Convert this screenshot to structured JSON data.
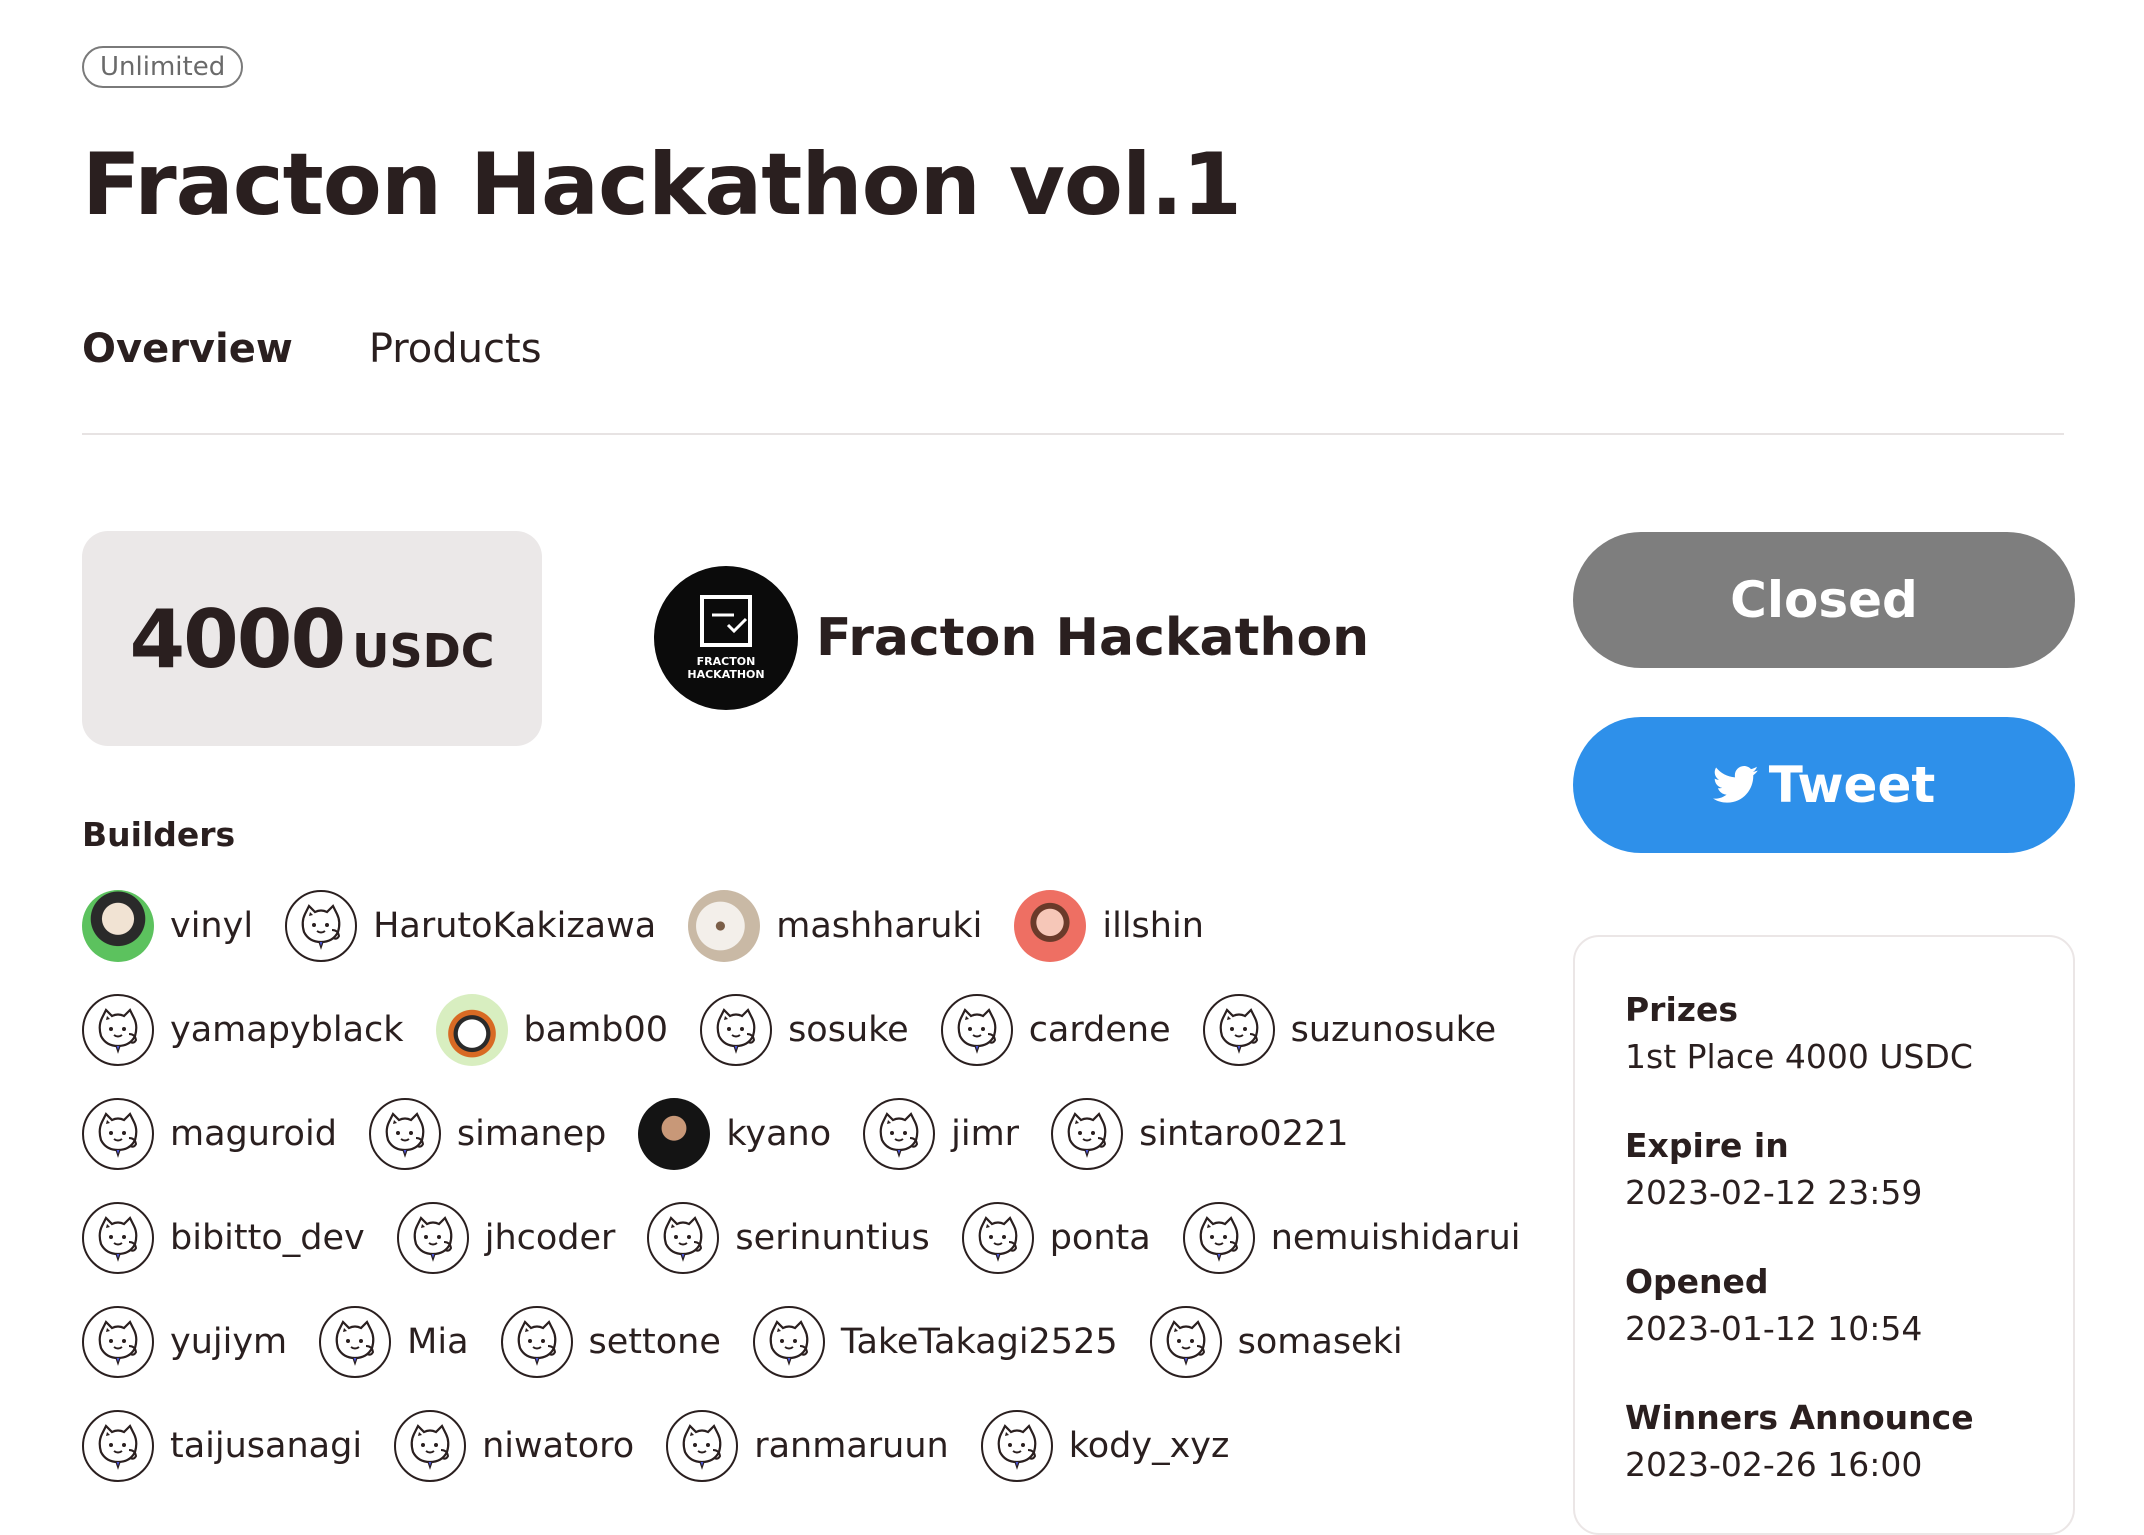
{
  "badge": "Unlimited",
  "title": "Fracton Hackathon vol.1",
  "tabs": [
    {
      "label": "Overview",
      "active": true
    },
    {
      "label": "Products",
      "active": false
    }
  ],
  "prize": {
    "amount": "4000",
    "unit": "USDC"
  },
  "organizer": {
    "name": "Fracton Hackathon",
    "logo_text_1": "FRACTON",
    "logo_text_2": "HACKATHON"
  },
  "builders_heading": "Builders",
  "builders": [
    [
      {
        "name": "vinyl",
        "avatar": "photo-green"
      },
      {
        "name": "HarutoKakizawa",
        "avatar": "cat-icon"
      },
      {
        "name": "mashharuki",
        "avatar": "photo-dog"
      },
      {
        "name": "illshin",
        "avatar": "photo-red"
      }
    ],
    [
      {
        "name": "yamapyblack",
        "avatar": "cat-icon"
      },
      {
        "name": "bamb00",
        "avatar": "photo-panda"
      },
      {
        "name": "sosuke",
        "avatar": "cat-icon"
      },
      {
        "name": "cardene",
        "avatar": "cat-icon"
      },
      {
        "name": "suzunosuke",
        "avatar": "cat-icon"
      }
    ],
    [
      {
        "name": "maguroid",
        "avatar": "cat-icon"
      },
      {
        "name": "simanep",
        "avatar": "cat-icon"
      },
      {
        "name": "kyano",
        "avatar": "photo-person"
      },
      {
        "name": "jimr",
        "avatar": "cat-icon"
      },
      {
        "name": "sintaro0221",
        "avatar": "cat-icon"
      }
    ],
    [
      {
        "name": "bibitto_dev",
        "avatar": "cat-icon"
      },
      {
        "name": "jhcoder",
        "avatar": "cat-icon"
      },
      {
        "name": "serinuntius",
        "avatar": "cat-icon"
      },
      {
        "name": "ponta",
        "avatar": "cat-icon"
      },
      {
        "name": "nemuishidarui",
        "avatar": "cat-icon"
      }
    ],
    [
      {
        "name": "yujiym",
        "avatar": "cat-icon"
      },
      {
        "name": "Mia",
        "avatar": "cat-icon"
      },
      {
        "name": "settone",
        "avatar": "cat-icon"
      },
      {
        "name": "TakeTakagi2525",
        "avatar": "cat-icon"
      },
      {
        "name": "somaseki",
        "avatar": "cat-icon"
      }
    ],
    [
      {
        "name": "taijusanagi",
        "avatar": "cat-icon"
      },
      {
        "name": "niwatoro",
        "avatar": "cat-icon"
      },
      {
        "name": "ranmaruun",
        "avatar": "cat-icon"
      },
      {
        "name": "kody_xyz",
        "avatar": "cat-icon"
      }
    ]
  ],
  "buttons": {
    "closed": "Closed",
    "tweet": "Tweet"
  },
  "info": [
    {
      "label": "Prizes",
      "value": "1st Place 4000 USDC"
    },
    {
      "label": "Expire in",
      "value": "2023-02-12 23:59"
    },
    {
      "label": "Opened",
      "value": "2023-01-12 10:54"
    },
    {
      "label": "Winners Announce",
      "value": "2023-02-26 16:00"
    }
  ],
  "colors": {
    "text": "#2a1f1f",
    "closed_button": "#7e7e7e",
    "tweet_button": "#2e90ea",
    "prize_box": "#ebe8e8"
  }
}
